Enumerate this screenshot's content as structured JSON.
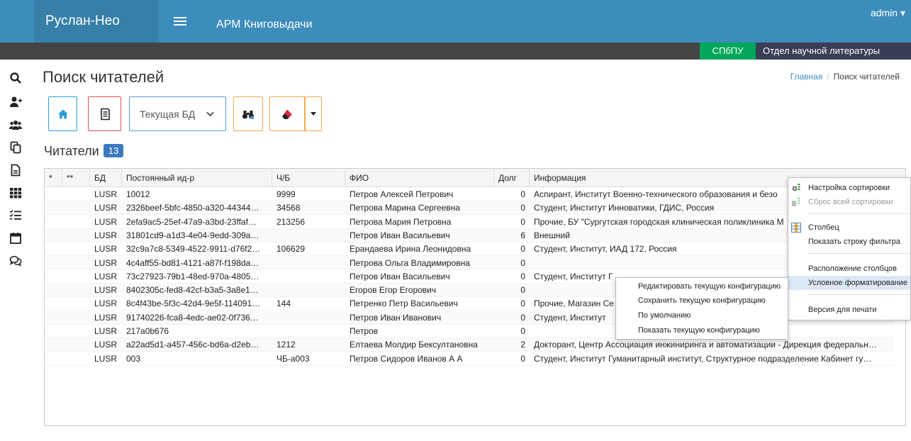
{
  "header": {
    "brand": "Руслан-Нео",
    "app_title": "АРМ Книговыдачи",
    "user": "admin",
    "org_badge": "СПбПУ",
    "org_department": "Отдел научной литературы"
  },
  "sidebar": {
    "items": [
      {
        "icon": "search-icon"
      },
      {
        "icon": "add-user-icon"
      },
      {
        "icon": "users-icon"
      },
      {
        "icon": "copy-icon"
      },
      {
        "icon": "document-icon"
      },
      {
        "icon": "grid-icon"
      },
      {
        "icon": "list-icon"
      },
      {
        "icon": "calendar-icon"
      },
      {
        "icon": "comments-icon"
      }
    ]
  },
  "page": {
    "title": "Поиск читателей",
    "breadcrumb_home": "Главная",
    "breadcrumb_current": "Поиск читателей"
  },
  "toolbar": {
    "db_select": "Текущая БД",
    "colors": {
      "home": "#2a9fd6",
      "document": "#d9534f",
      "select": "#5b9bd5",
      "search": "#f0ad4e",
      "clear": "#f0ad4e"
    }
  },
  "grid": {
    "title": "Читатели",
    "count": "13",
    "headers": [
      "*",
      "**",
      "БД",
      "Постоянный ид-р",
      "Ч/Б",
      "ФИО",
      "Долг",
      "Информация"
    ],
    "rows": [
      {
        "db": "LUSR",
        "id": "10012",
        "cb": "9999",
        "name": "Петров Алексей Петрович",
        "debt": "0",
        "info": "Аспирант, Институт Военно-технического образования и безо"
      },
      {
        "db": "LUSR",
        "id": "2326beef-5bfc-4850-a320-44344…",
        "cb": "34568",
        "name": "Петрова Марина Сергеевна",
        "debt": "0",
        "info": "Студент, Институт Инноватики, ГДИС, Россия"
      },
      {
        "db": "LUSR",
        "id": "2efa9ac5-25ef-47a9-a3bd-23ffaf…",
        "cb": "213256",
        "name": "Петрова Мария Петровна",
        "debt": "0",
        "info": "Прочие, БУ \"Сургутская городская клиническая поликлиника М"
      },
      {
        "db": "LUSR",
        "id": "31801cd9-a1d3-4e04-9edd-309a…",
        "cb": "",
        "name": "Петров Иван Васильевич",
        "debt": "6",
        "info": "Внешний"
      },
      {
        "db": "LUSR",
        "id": "32c9a7c8-5349-4522-9911-d76f2…",
        "cb": "106629",
        "name": "Ерандаева Ирина Леонидовна",
        "debt": "0",
        "info": "Студент, Институт, ИАД 172, Россия"
      },
      {
        "db": "LUSR",
        "id": "4c4aff55-bd81-4121-a87f-f198da…",
        "cb": "",
        "name": "Петрова Ольга Владимировна",
        "debt": "0",
        "info": ""
      },
      {
        "db": "LUSR",
        "id": "73c27923-79b1-48ed-970a-4805…",
        "cb": "",
        "name": "Петров Иван Васильевич",
        "debt": "0",
        "info": "Студент, Институт Г"
      },
      {
        "db": "LUSR",
        "id": "8402305c-fed8-42cf-b3a5-3a8e1…",
        "cb": "",
        "name": "Егоров Егор Егорович",
        "debt": "0",
        "info": ""
      },
      {
        "db": "LUSR",
        "id": "8c4f43be-5f3c-42d4-9e5f-114091…",
        "cb": "144",
        "name": "Петренко Петр Васильевич",
        "debt": "0",
        "info": "Прочие, Магазин Се"
      },
      {
        "db": "LUSR",
        "id": "91740226-fca8-4edc-ae02-0f736…",
        "cb": "",
        "name": "Петров Иван Иванович",
        "debt": "0",
        "info": "Студент, Институт"
      },
      {
        "db": "LUSR",
        "id": "217a0b676",
        "cb": "",
        "name": "Петров",
        "debt": "0",
        "info": ""
      },
      {
        "db": "LUSR",
        "id": "a22ad5d1-a457-456c-bd6a-d2eb…",
        "cb": "1212",
        "name": "Елтаева Молдир Бексултановна",
        "debt": "2",
        "info": "Докторант, Центр Ассоциация инжиниринга и автоматизации - Дирекция федеральн…"
      },
      {
        "db": "LUSR",
        "id": "003",
        "cb": "ЧБ-а003",
        "name": "Петров Сидоров Иванов А А",
        "debt": "0",
        "info": "Студент, Институт Гуманитарный институт, Структурное подразделение Кабинет гу…"
      }
    ]
  },
  "context_menu": {
    "items": [
      {
        "label": "Настройка сортировки",
        "disabled": false,
        "icon": "sort-settings-icon"
      },
      {
        "label": "Сброс всей сортировки",
        "disabled": true,
        "icon": "sort-reset-icon"
      },
      {
        "label": "Столбец",
        "disabled": false,
        "icon": "column-icon"
      },
      {
        "label": "Показать строку фильтра",
        "disabled": false,
        "icon": ""
      },
      {
        "label": "Расположение столбцов",
        "disabled": false,
        "icon": ""
      },
      {
        "label": "Условное форматирование",
        "disabled": false,
        "icon": ""
      },
      {
        "label": "Версия для печати",
        "disabled": false,
        "icon": ""
      }
    ]
  },
  "submenu": {
    "items": [
      {
        "label": "Редактировать текущую конфигурацию"
      },
      {
        "label": "Сохранить текущую конфигурацию"
      },
      {
        "label": "По умолчанию"
      },
      {
        "label": "Показать текущую конфигурацию"
      }
    ]
  }
}
